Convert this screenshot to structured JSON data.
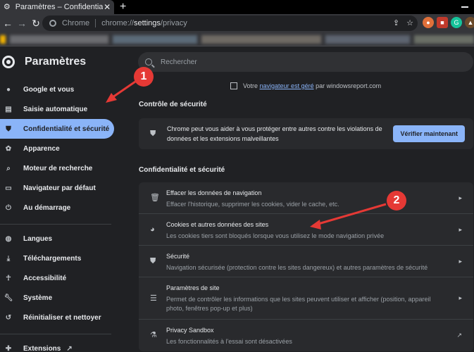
{
  "browser": {
    "tab_title": "Paramètres – Confidentialité et sé",
    "new_tab": "+",
    "chrome_label": "Chrome",
    "url_prefix": "chrome://",
    "url_host": "settings",
    "url_path": "/privacy"
  },
  "header": {
    "title": "Paramètres",
    "search_placeholder": "Rechercher"
  },
  "sidebar": {
    "items": [
      {
        "label": "Google et vous",
        "icon": "person-icon",
        "active": false
      },
      {
        "label": "Saisie automatique",
        "icon": "clipboard-icon",
        "active": false
      },
      {
        "label": "Confidentialité et sécurité",
        "icon": "shield-icon",
        "active": true
      },
      {
        "label": "Apparence",
        "icon": "palette-icon",
        "active": false
      },
      {
        "label": "Moteur de recherche",
        "icon": "search-icon",
        "active": false
      },
      {
        "label": "Navigateur par défaut",
        "icon": "browser-icon",
        "active": false
      },
      {
        "label": "Au démarrage",
        "icon": "power-icon",
        "active": false
      }
    ],
    "advanced_items": [
      {
        "label": "Langues",
        "icon": "globe-icon"
      },
      {
        "label": "Téléchargements",
        "icon": "download-icon"
      },
      {
        "label": "Accessibilité",
        "icon": "accessibility-icon"
      },
      {
        "label": "Système",
        "icon": "wrench-icon"
      },
      {
        "label": "Réinitialiser et nettoyer",
        "icon": "history-icon"
      }
    ],
    "extensions_label": "Extensions"
  },
  "main": {
    "managed_prefix": "Votre",
    "managed_link": "navigateur est géré",
    "managed_suffix": "par windowsreport.com",
    "safety_title": "Contrôle de sécurité",
    "safety_text": "Chrome peut vous aider à vous protéger entre autres contre les violations de données et les extensions malveillantes",
    "safety_button": "Vérifier maintenant",
    "privacy_title": "Confidentialité et sécurité",
    "rows": [
      {
        "name": "Effacer les données de navigation",
        "desc": "Effacer l'historique, supprimer les cookies, vider le cache, etc.",
        "icon": "trash-icon"
      },
      {
        "name": "Cookies et autres données des sites",
        "desc": "Les cookies tiers sont bloqués lorsque vous utilisez le mode navigation privée",
        "icon": "cookie-icon"
      },
      {
        "name": "Sécurité",
        "desc": "Navigation sécurisée (protection contre les sites dangereux) et autres paramètres de sécurité",
        "icon": "shield-icon"
      },
      {
        "name": "Paramètres de site",
        "desc": "Permet de contrôler les informations que les sites peuvent utiliser et afficher (position, appareil photo, fenêtres pop-up et plus)",
        "icon": "sliders-icon"
      },
      {
        "name": "Privacy Sandbox",
        "desc": "Les fonctionnalités à l'essai sont désactivées",
        "icon": "flask-icon"
      }
    ]
  },
  "annotations": {
    "badge_1": "1",
    "badge_2": "2",
    "color": "#e53935"
  },
  "colors": {
    "accent": "#8ab4f8",
    "background": "#202124",
    "card": "#292a2d"
  }
}
